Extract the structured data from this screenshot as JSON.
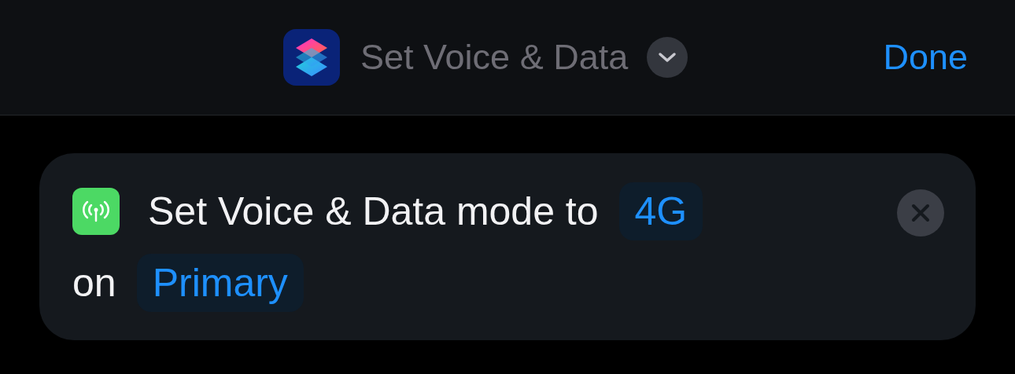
{
  "header": {
    "title": "Set Voice & Data",
    "done": "Done"
  },
  "action": {
    "lines": [
      [
        {
          "kind": "text",
          "text": "Set Voice & Data mode to"
        },
        {
          "kind": "param",
          "text": "4G"
        }
      ],
      [
        {
          "kind": "text",
          "text": "on"
        },
        {
          "kind": "param",
          "text": "Primary"
        }
      ]
    ]
  }
}
